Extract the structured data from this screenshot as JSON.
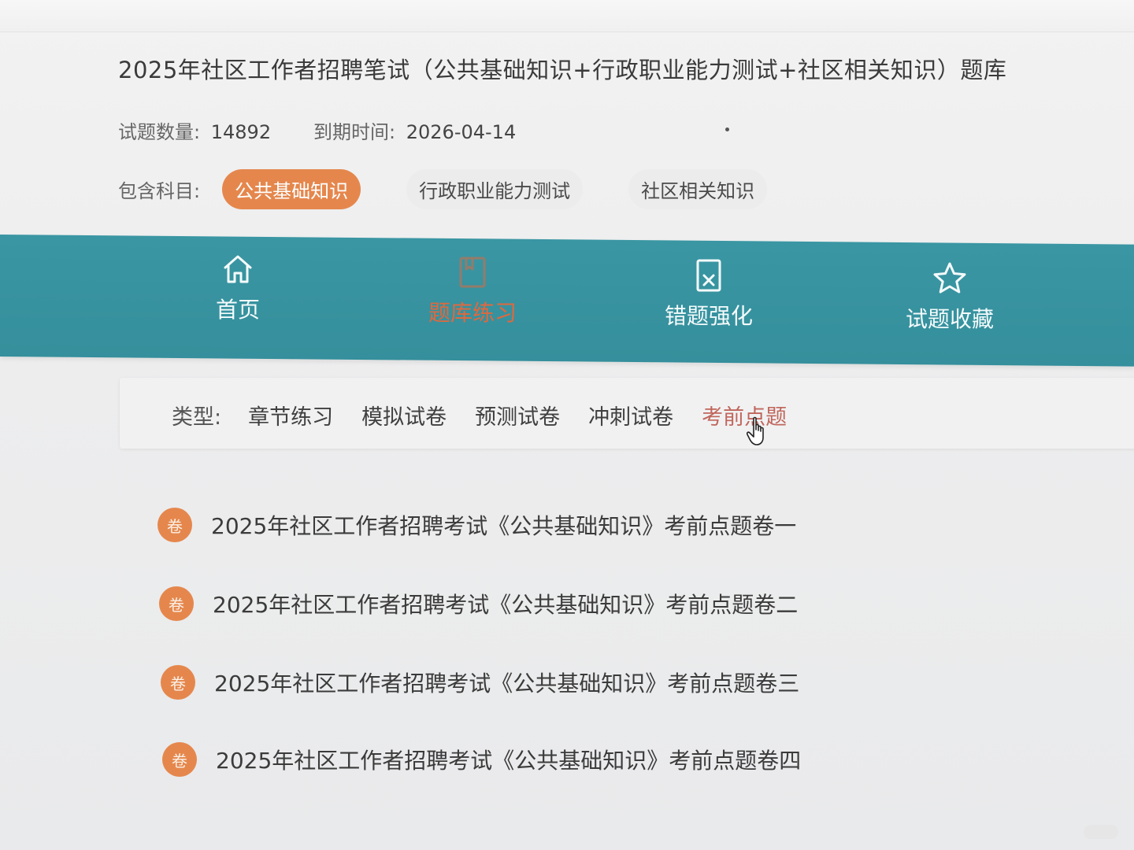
{
  "header": {
    "title": "2025年社区工作者招聘笔试（公共基础知识+行政职业能力测试+社区相关知识）题库",
    "question_count_label": "试题数量:",
    "question_count_value": "14892",
    "expire_label": "到期时间:",
    "expire_value": "2026-04-14",
    "subjects_label": "包含科目:",
    "subjects": [
      {
        "label": "公共基础知识",
        "active": true
      },
      {
        "label": "行政职业能力测试",
        "active": false
      },
      {
        "label": "社区相关知识",
        "active": false
      }
    ]
  },
  "nav": {
    "items": [
      {
        "label": "首页",
        "icon": "home-icon",
        "active": false
      },
      {
        "label": "题库练习",
        "icon": "notebook-icon",
        "active": true
      },
      {
        "label": "错题强化",
        "icon": "wrong-question-icon",
        "active": false
      },
      {
        "label": "试题收藏",
        "icon": "star-icon",
        "active": false
      }
    ]
  },
  "filter": {
    "label": "类型:",
    "tabs": [
      {
        "label": "章节练习",
        "active": false
      },
      {
        "label": "模拟试卷",
        "active": false
      },
      {
        "label": "预测试卷",
        "active": false
      },
      {
        "label": "冲刺试卷",
        "active": false
      },
      {
        "label": "考前点题",
        "active": true
      }
    ]
  },
  "exams": {
    "badge": "卷",
    "items": [
      {
        "title": "2025年社区工作者招聘考试《公共基础知识》考前点题卷一"
      },
      {
        "title": "2025年社区工作者招聘考试《公共基础知识》考前点题卷二"
      },
      {
        "title": "2025年社区工作者招聘考试《公共基础知识》考前点题卷三"
      },
      {
        "title": "2025年社区工作者招聘考试《公共基础知识》考前点题卷四"
      }
    ]
  },
  "colors": {
    "accent_orange": "#e5874d",
    "nav_teal": "#3a96a3",
    "active_tab_red": "#c0665c"
  }
}
